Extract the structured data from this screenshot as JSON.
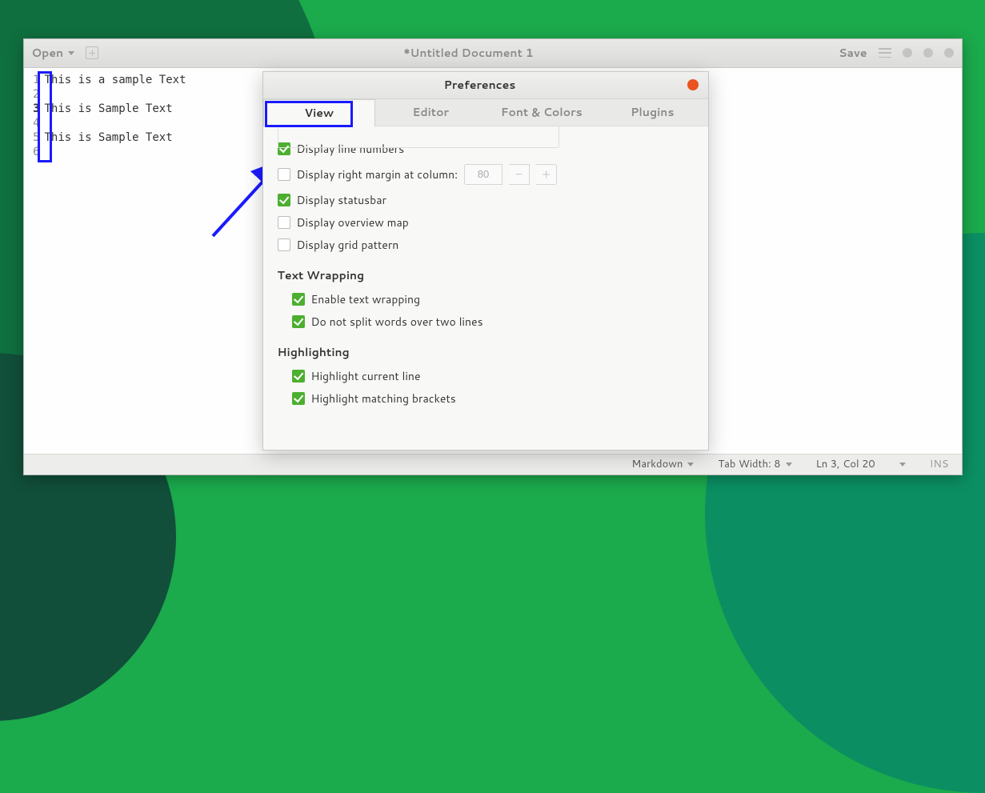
{
  "titlebar": {
    "open_label": "Open",
    "title": "*Untitled Document 1",
    "save_label": "Save"
  },
  "editor": {
    "lines": [
      {
        "num": "1",
        "text": "This is a sample Text"
      },
      {
        "num": "2",
        "text": ""
      },
      {
        "num": "3",
        "text": "This is Sample Text"
      },
      {
        "num": "4",
        "text": ""
      },
      {
        "num": "5",
        "text": "This is Sample Text"
      },
      {
        "num": "6",
        "text": ""
      }
    ],
    "active_line_index": 2
  },
  "statusbar": {
    "lang": "Markdown",
    "tab": "Tab Width: 8",
    "pos": "Ln 3, Col 20",
    "mode": "INS"
  },
  "prefs": {
    "title": "Preferences",
    "tabs": {
      "view": "View",
      "editor": "Editor",
      "fonts": "Font & Colors",
      "plugins": "Plugins"
    },
    "opts": {
      "line_numbers": "Display line numbers",
      "right_margin": "Display right margin at column:",
      "right_margin_val": "80",
      "statusbar": "Display statusbar",
      "overview": "Display overview map",
      "grid": "Display grid pattern"
    },
    "sections": {
      "wrap": "Text Wrapping",
      "hl": "Highlighting"
    },
    "wrap": {
      "enable": "Enable text wrapping",
      "nosplit": "Do not split words over two lines"
    },
    "highlight": {
      "curline": "Highlight current line",
      "brackets": "Highlight matching brackets"
    }
  }
}
